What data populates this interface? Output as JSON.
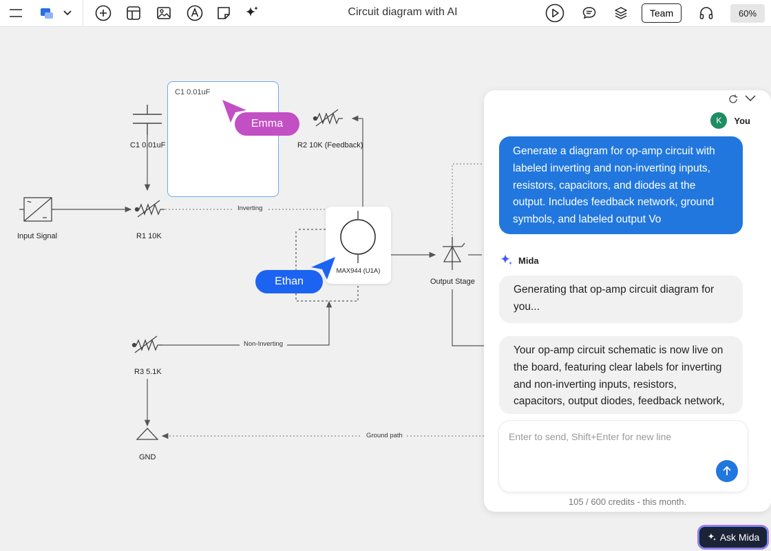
{
  "topbar": {
    "doc_title": "Circuit diagram with AI",
    "team_label": "Team",
    "zoom": "60%"
  },
  "icons": {
    "menu": "menu-icon",
    "shapes": "shapes-icon",
    "chevron": "chevron-down-icon",
    "add": "add-icon",
    "template": "template-icon",
    "image": "image-icon",
    "text": "text-icon",
    "sticky": "sticky-note-icon",
    "ai": "sparkle-icon",
    "present": "play-icon",
    "comment": "comment-icon",
    "layers": "layers-icon",
    "audio": "headphones-icon"
  },
  "canvas": {
    "selected_label": "C1 0.01uF",
    "labels": {
      "c1": "C1 0.01uF",
      "r2": "R2 10K (Feedback)",
      "input": "Input Signal",
      "r1": "R1 10K",
      "opamp": "MAX944 (U1A)",
      "output_stage": "Output Stage",
      "r3": "R3 5.1K",
      "gnd": "GND"
    },
    "wire_labels": {
      "inverting": "Inverting",
      "non_inverting": "Non-Inverting",
      "ground_path": "Ground path"
    },
    "cursors": [
      {
        "name": "Emma",
        "color": "#c34fc4"
      },
      {
        "name": "Ethan",
        "color": "#1c63f1"
      }
    ]
  },
  "chat": {
    "user_initial": "K",
    "user_name": "You",
    "user_message": "Generate a diagram for op-amp circuit with labeled inverting and non-inverting inputs, resistors, capacitors, and diodes at the output. Includes feedback network, ground symbols, and labeled output Vo",
    "assistant_name": "Mida",
    "assistant_messages": [
      "Generating that op-amp circuit diagram for you...",
      "Your op-amp circuit schematic is now live on the board, featuring clear labels for inverting and non-inverting inputs, resistors, capacitors, output diodes, feedback network,"
    ],
    "input_placeholder": "Enter to send, Shift+Enter for new line",
    "input_value": "",
    "credits": "105 / 600 credits - this month."
  },
  "ask_mida_label": "Ask Mida",
  "colors": {
    "accent": "#2177de",
    "emma": "#c34fc4",
    "ethan": "#1c63f1",
    "selection": "#6aa9f5"
  }
}
